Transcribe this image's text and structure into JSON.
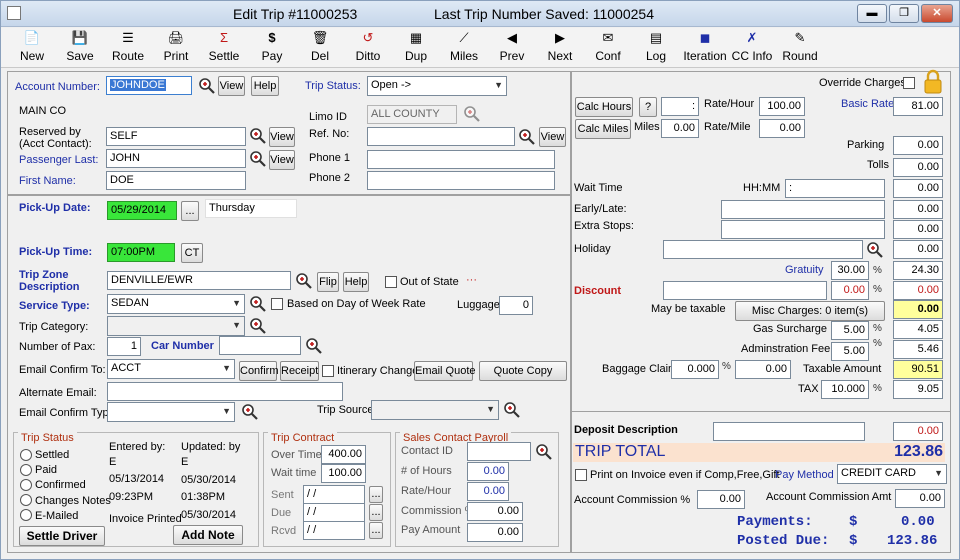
{
  "window": {
    "title": "Edit Trip #11000253",
    "last_saved": "Last Trip Number Saved: 11000254",
    "btn_min": "▬",
    "btn_max": "❐",
    "btn_close": "✕"
  },
  "toolbar": [
    {
      "label": "New",
      "icon": "📄"
    },
    {
      "label": "Save",
      "icon": "💾"
    },
    {
      "label": "Route",
      "icon": "☰"
    },
    {
      "label": "Print",
      "icon": "🖨"
    },
    {
      "label": "Settle",
      "icon": "Σ"
    },
    {
      "label": "Pay",
      "icon": "$"
    },
    {
      "label": "Del",
      "icon": "🗑"
    },
    {
      "label": "Ditto",
      "icon": "↺"
    },
    {
      "label": "Dup",
      "icon": "▦"
    },
    {
      "label": "Miles",
      "icon": "⟋"
    },
    {
      "label": "Prev",
      "icon": "◀"
    },
    {
      "label": "Next",
      "icon": "▶"
    },
    {
      "label": "Conf",
      "icon": "✉"
    },
    {
      "label": "Log",
      "icon": "▤"
    },
    {
      "label": "Iteration",
      "icon": "◼"
    },
    {
      "label": "CC Info",
      "icon": "✗"
    },
    {
      "label": "Round",
      "icon": "✎"
    }
  ],
  "account": {
    "label": "Account Number:",
    "value": "JOHNDOE",
    "view": "View",
    "help": "Help",
    "company": "MAIN CO",
    "trip_status_label": "Trip Status:",
    "trip_status": "Open ->",
    "limo_label": "Limo ID",
    "limo_value": "ALL COUNTY",
    "ref_label": "Ref. No:",
    "ref_value": "",
    "ref_view": "View",
    "reserved_label": "Reserved by\n(Acct Contact):",
    "reserved_value": "SELF",
    "passenger_label": "Passenger Last:",
    "passenger_value": "JOHN",
    "first_label": "First Name:",
    "first_value": "DOE",
    "phone1_label": "Phone 1",
    "phone2_label": "Phone 2",
    "phone1": "",
    "phone2": ""
  },
  "trip": {
    "pickup_date_label": "Pick-Up Date:",
    "pickup_date": "05/29/2014",
    "pickup_dow": "Thursday",
    "ellipsis": "...",
    "pickup_time_label": "Pick-Up Time:",
    "pickup_time": "07:00PM",
    "ct": "CT",
    "zone_label": "Trip Zone\nDescription",
    "zone_value": "DENVILLE/EWR",
    "flip": "Flip",
    "help": "Help",
    "out_of_state": "Out of State",
    "dots": "···",
    "service_label": "Service Type:",
    "service_value": "SEDAN",
    "dow_rate": "Based on Day of Week Rate",
    "luggage_label": "Luggage",
    "luggage_value": "0",
    "category_label": "Trip Category:",
    "category_value": "",
    "pax_label": "Number of Pax:",
    "pax_value": "1",
    "car_label": "Car Number",
    "car_value": "",
    "email_to_label": "Email Confirm To:",
    "email_to_value": "ACCT",
    "confirm": "Confirm",
    "receipt": "Receipt",
    "itinerary": "Itinerary Change",
    "email_quote": "Email Quote",
    "quote_copy": "Quote Copy",
    "alt_email_label": "Alternate Email:",
    "alt_email": "",
    "email_type_label": "Email Confirm Type:",
    "email_type": "",
    "source_label": "Trip Source",
    "source_value": ""
  },
  "trip_status_group": {
    "title": "Trip Status",
    "options": [
      "Settled",
      "Paid",
      "Confirmed",
      "Changes Notes",
      "E-Mailed"
    ],
    "entered_by_label": "Entered by:",
    "entered_by": "E",
    "updated_by_label": "Updated: by",
    "updated_by": "E",
    "entered_date": "05/13/2014",
    "entered_time": "09:23PM",
    "updated_date": "05/30/2014",
    "updated_time": "01:38PM",
    "invoice_printed_label": "Invoice Printed",
    "invoice_printed": "05/30/2014",
    "settle_driver": "Settle Driver",
    "add_note": "Add Note"
  },
  "trip_contract": {
    "title": "Trip Contract",
    "over_time_label": "Over Time",
    "over_time": "400.00",
    "wait_time_label": "Wait time",
    "wait_time": "100.00",
    "sent_label": "Sent",
    "due_label": "Due",
    "rcvd_label": "Rcvd",
    "sent": " / /",
    "due": " / /",
    "rcvd": " / /",
    "ellipsis": "..."
  },
  "sales_payroll": {
    "title": "Sales Contact Payroll",
    "contact_label": "Contact  ID",
    "contact": "",
    "hours_label": "# of Hours",
    "hours": "0.00",
    "rate_label": "Rate/Hour",
    "rate": "0.00",
    "commission_label": "Commission %",
    "commission": "0.00",
    "pay_label": "Pay Amount",
    "pay": "0.00"
  },
  "rates": {
    "override_label": "Override Charges",
    "calc_hours": "Calc Hours",
    "q": "?",
    "hours_value": ":",
    "rate_hour_label": "Rate/Hour",
    "rate_hour": "100.00",
    "basic_rate_label": "Basic Rate",
    "basic_rate": "81.00",
    "calc_miles": "Calc Miles",
    "miles_label": "Miles",
    "miles": "0.00",
    "rate_mile_label": "Rate/Mile",
    "rate_mile": "0.00",
    "parking_label": "Parking",
    "parking": "0.00",
    "tolls_label": "Tolls",
    "tolls": "0.00",
    "wait_label": "Wait Time",
    "hhmm_label": "HH:MM",
    "hhmm": ":",
    "wait_amt": "0.00",
    "early_label": "Early/Late:",
    "early": "",
    "early_amt": "0.00",
    "extra_label": "Extra Stops:",
    "extra": "",
    "extra_amt": "0.00",
    "holiday_label": "Holiday",
    "holiday": "",
    "holiday_amt": "0.00",
    "gratuity_label": "Gratuity",
    "gratuity_pct": "30.00",
    "gratuity_amt": "24.30",
    "discount_label": "Discount",
    "discount": "",
    "discount_pct": "0.00",
    "discount_amt": "0.00",
    "may_tax_label": "May be taxable",
    "misc_charges": "Misc Charges:  0 item(s)",
    "misc_amt": "0.00",
    "gas_label": "Gas Surcharge",
    "gas_pct": "5.00",
    "gas_amt": "4.05",
    "admin_label": "Adminstration Fee",
    "admin_pct": "5.00",
    "admin_amt": "5.46",
    "baggage_label": "Baggage Claim",
    "baggage_pct": "0.000",
    "baggage_amt": "0.00",
    "taxable_label": "Taxable Amount",
    "taxable_amt": "90.51",
    "tax_label": "TAX",
    "tax_pct": "10.000",
    "tax_amt": "9.05",
    "pct": "%"
  },
  "totals": {
    "deposit_label": "Deposit Description",
    "deposit": "",
    "deposit_amt": "0.00",
    "trip_total_label": "TRIP TOTAL",
    "trip_total": "123.86",
    "print_invoice": "Print on Invoice even if Comp,Free,Gift",
    "pay_method_label": "Pay Method",
    "pay_method": "CREDIT CARD",
    "acct_comm_label": "Account Commission %",
    "acct_comm": "0.00",
    "acct_comm_amt_label": "Account Commission Amt",
    "acct_comm_amt": "0.00",
    "payments_label": "Payments:",
    "payments_cur": "$",
    "payments": "0.00",
    "posted_label": "Posted Due:",
    "posted_cur": "$",
    "posted": "123.86"
  }
}
